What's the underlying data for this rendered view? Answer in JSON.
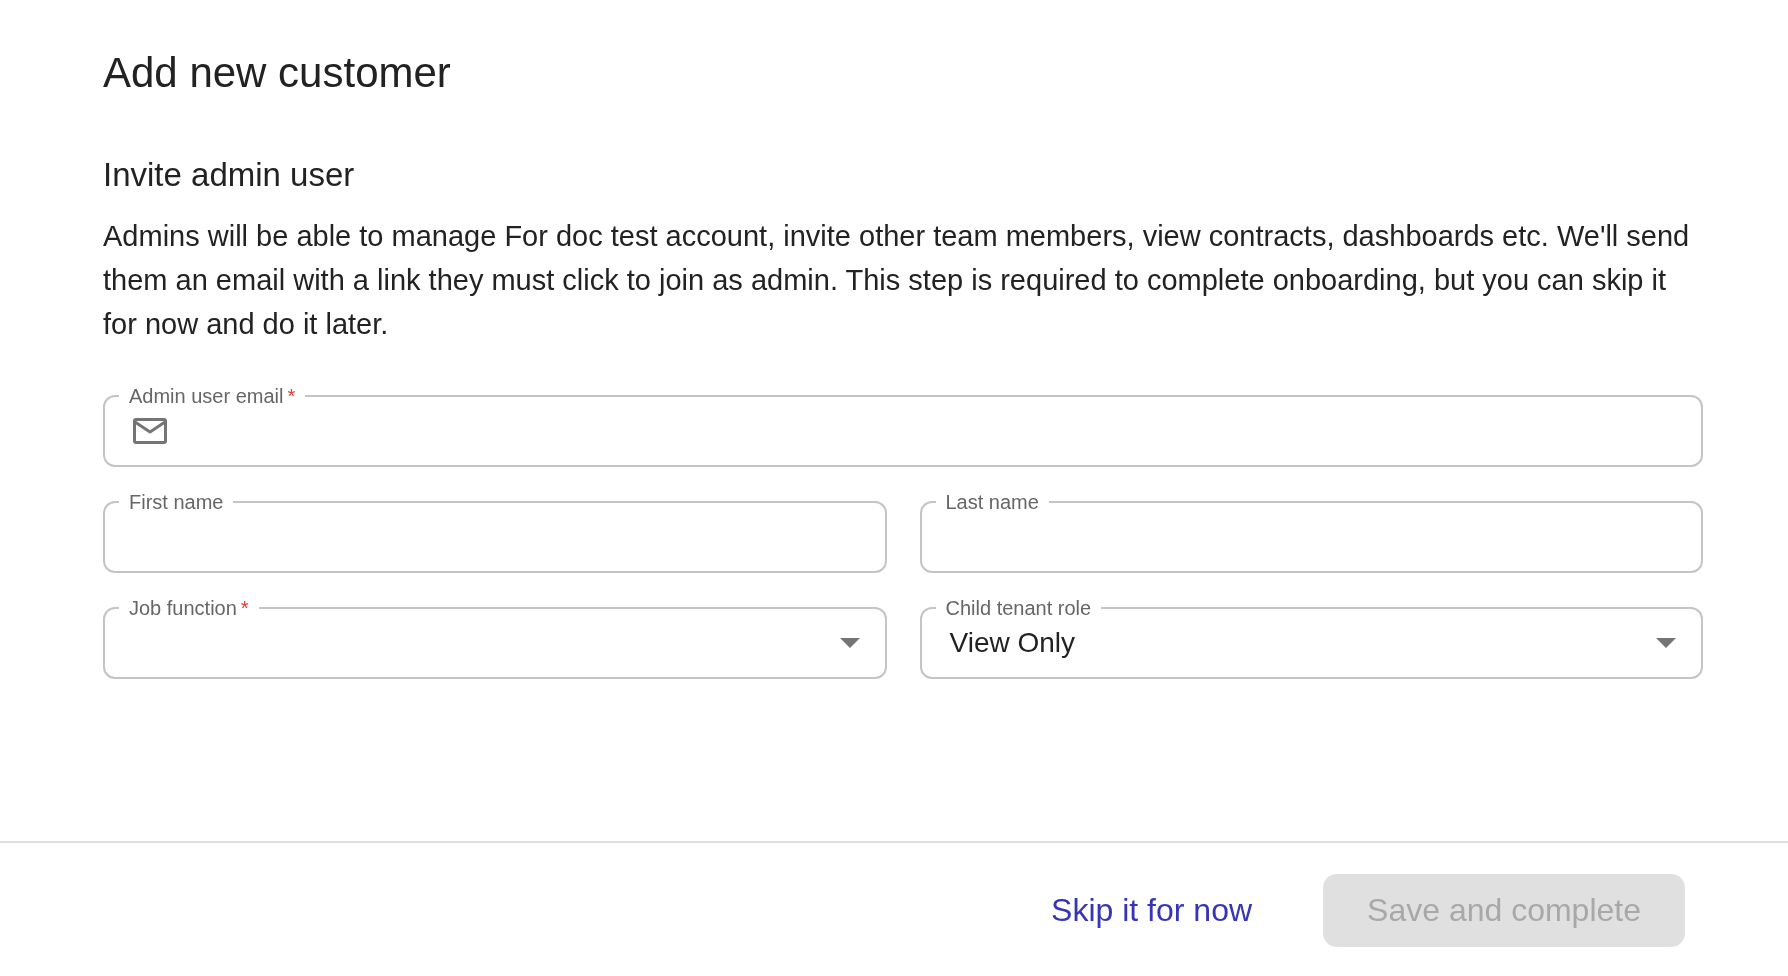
{
  "page": {
    "title": "Add new customer"
  },
  "section": {
    "heading": "Invite admin user",
    "description": "Admins will be able to manage For doc test account, invite other team members, view contracts, dashboards etc. We'll send them an email with a link they must click to join as admin. This step is required to complete onboarding, but you can skip it for now and do it later."
  },
  "fields": [
    {
      "kind": "email",
      "label": "Admin user email",
      "required_mark": "*"
    },
    {
      "kind": "text",
      "label": "First name"
    },
    {
      "kind": "text",
      "label": "Last name"
    },
    {
      "kind": "select",
      "label": "Job function",
      "required_mark": "*"
    },
    {
      "kind": "select",
      "label": "Child tenant role",
      "value": "View Only"
    }
  ],
  "actions": [
    {
      "kind": "link",
      "label": "Skip it for now",
      "disabled": false
    },
    {
      "kind": "button",
      "label": "Save and complete",
      "disabled": true
    }
  ]
}
